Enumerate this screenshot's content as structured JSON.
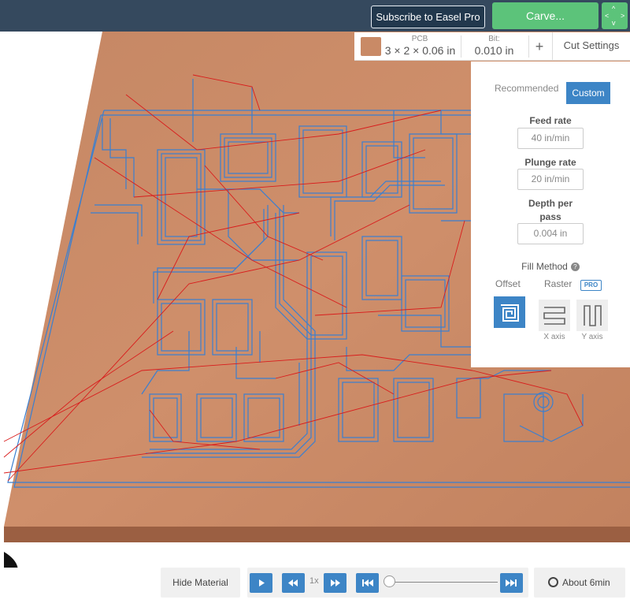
{
  "header": {
    "subscribe_label": "Subscribe to Easel Pro",
    "carve_label": "Carve...",
    "expand_icon": "expand-arrows-icon"
  },
  "material_bar": {
    "material_name": "PCB",
    "dimensions": "3 × 2 × 0.06 in",
    "bit_label": "Bit:",
    "bit_value": "0.010 in",
    "add_label": "+",
    "cut_settings_label": "Cut Settings"
  },
  "cut_settings": {
    "tabs": {
      "recommended": "Recommended",
      "custom": "Custom",
      "active": "Custom"
    },
    "feed_rate_label": "Feed rate",
    "feed_rate_value": "40 in/min",
    "plunge_rate_label": "Plunge rate",
    "plunge_rate_value": "20 in/min",
    "depth_label_line1": "Depth per",
    "depth_label_line2": "pass",
    "depth_value": "0.004 in",
    "fill_method_label": "Fill Method",
    "offset_label": "Offset",
    "raster_label": "Raster",
    "pro_badge": "PRO",
    "x_axis_label": "X axis",
    "y_axis_label": "Y axis",
    "selected_fill": "Offset"
  },
  "playback": {
    "hide_material_label": "Hide Material",
    "speed": "1x",
    "progress": 0,
    "estimate": "About 6min"
  },
  "colors": {
    "topbar": "#35495e",
    "carve_green": "#5cc37a",
    "accent_blue": "#3d85c6",
    "material": "#c98a66",
    "toolpath": "#3a7fd0",
    "rapid_move": "#d91c1c"
  }
}
